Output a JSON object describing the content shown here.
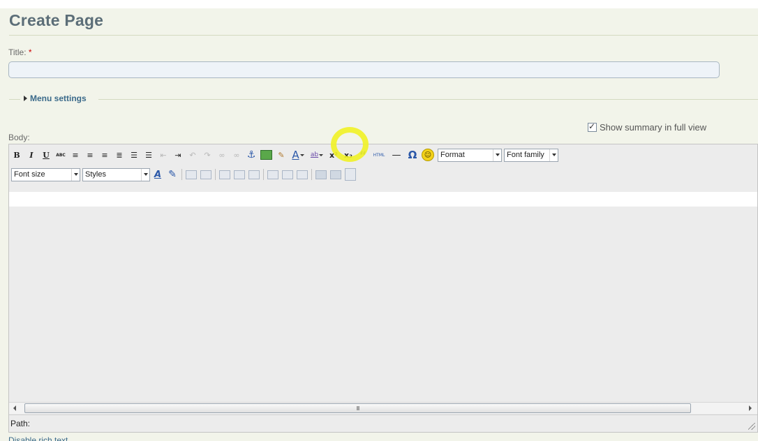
{
  "page": {
    "title": "Create Page"
  },
  "title_field": {
    "label": "Title:",
    "required_mark": "*",
    "value": ""
  },
  "menu_settings": {
    "label": "Menu settings"
  },
  "summary_toggle": {
    "label": "Show summary in full view",
    "checked": true
  },
  "body_field": {
    "label": "Body:"
  },
  "toolbar": {
    "row1_buttons": [
      {
        "name": "bold",
        "glyph": "B"
      },
      {
        "name": "italic",
        "glyph": "I"
      },
      {
        "name": "underline",
        "glyph": "U"
      },
      {
        "name": "strikethrough",
        "glyph": "ABC"
      },
      {
        "name": "align-left",
        "glyph": "≡"
      },
      {
        "name": "align-center",
        "glyph": "≡"
      },
      {
        "name": "align-right",
        "glyph": "≡"
      },
      {
        "name": "align-justify",
        "glyph": "≣"
      },
      {
        "name": "bullet-list",
        "glyph": "☰"
      },
      {
        "name": "numbered-list",
        "glyph": "☰"
      },
      {
        "name": "outdent",
        "glyph": "⇤"
      },
      {
        "name": "indent",
        "glyph": "⇥"
      },
      {
        "name": "undo",
        "glyph": "↶"
      },
      {
        "name": "redo",
        "glyph": "↷"
      },
      {
        "name": "link",
        "glyph": "∞"
      },
      {
        "name": "unlink",
        "glyph": "∞"
      },
      {
        "name": "anchor",
        "glyph": "⚓"
      },
      {
        "name": "insert-image"
      },
      {
        "name": "cleanup",
        "glyph": "✎"
      },
      {
        "name": "text-color",
        "glyph": "A"
      },
      {
        "name": "highlight-color",
        "glyph": "ab"
      },
      {
        "name": "superscript",
        "glyph": "x²"
      },
      {
        "name": "subscript",
        "glyph": "x₂"
      },
      {
        "name": "blockquote",
        "glyph": "“"
      },
      {
        "name": "html",
        "glyph": "HTML"
      },
      {
        "name": "horizontal-rule",
        "glyph": "—"
      },
      {
        "name": "special-char",
        "glyph": "Ω"
      },
      {
        "name": "emoticons",
        "glyph": "☺"
      }
    ],
    "format_select": "Format",
    "font_family_select": "Font family",
    "font_size_select": "Font size",
    "styles_select": "Styles",
    "row2_buttons": [
      {
        "name": "font-size-style",
        "glyph": "A"
      },
      {
        "name": "edit-style",
        "glyph": "✎"
      }
    ]
  },
  "scrollbar": {
    "thumb_glyph": "III"
  },
  "path_bar": {
    "label": "Path:"
  },
  "disable_rich_text": "Disable rich text",
  "colors": {
    "highlight": "#f1f226",
    "link": "#3b6a8a",
    "title": "#5c6e78"
  }
}
